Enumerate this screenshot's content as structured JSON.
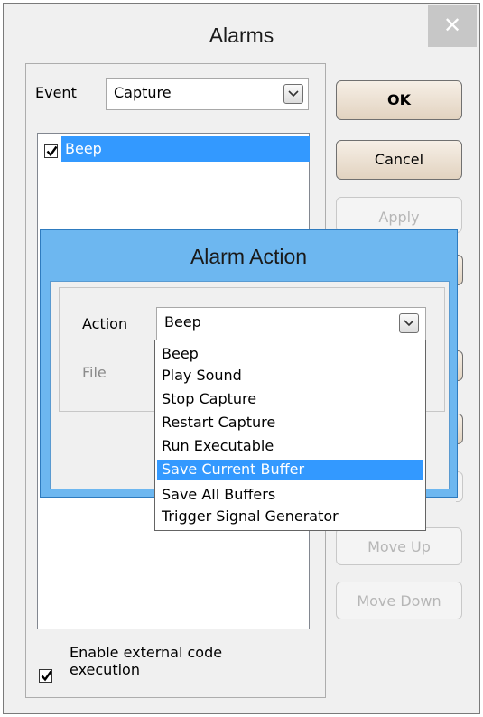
{
  "window": {
    "title": "Alarms",
    "close_glyph": "✕"
  },
  "event": {
    "label": "Event",
    "value": "Capture"
  },
  "alarm_list": {
    "items": [
      {
        "label": "Beep",
        "checked": true
      }
    ]
  },
  "buttons": {
    "ok": "OK",
    "cancel": "Cancel",
    "apply": "Apply",
    "move_up": "Move Up",
    "move_down": "Move Down"
  },
  "external_code": {
    "label_line1": "Enable external code",
    "label_line2": "execution",
    "checked": true
  },
  "dialog": {
    "title": "Alarm Action",
    "action_label": "Action",
    "action_value": "Beep",
    "file_label": "File"
  },
  "dropdown": {
    "options": [
      "Beep",
      "Play Sound",
      "Stop Capture",
      "Restart Capture",
      "Run Executable",
      "Save Current Buffer",
      "Save All Buffers",
      "Trigger Signal Generator"
    ],
    "highlighted": "Save Current Buffer"
  },
  "colors": {
    "selection": "#3399ff",
    "dialog_frame": "#6db7f0",
    "window_bg": "#f0f0f0"
  },
  "icons": [
    "close-icon",
    "chevron-down-icon",
    "checkmark-icon"
  ]
}
